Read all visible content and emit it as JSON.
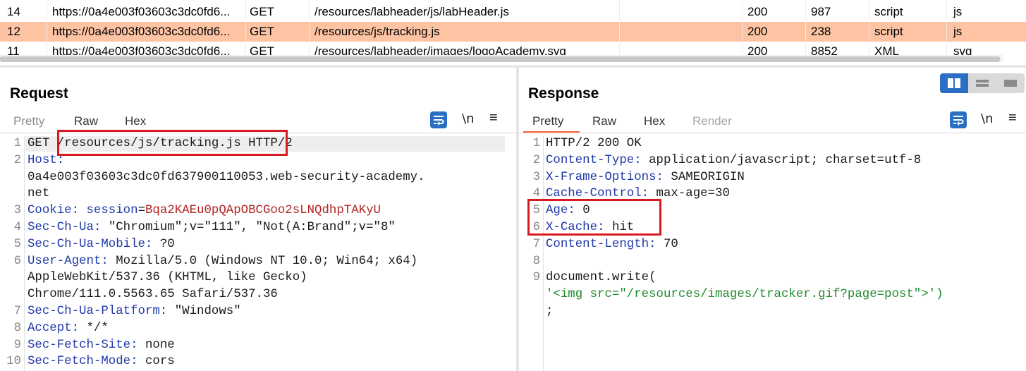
{
  "history": {
    "rows": [
      {
        "id": "14",
        "url": "https://0a4e003f03603c3dc0fd6...",
        "method": "GET",
        "path": "/resources/labheader/js/labHeader.js",
        "status": "200",
        "length": "987",
        "mime": "script",
        "ext": "js"
      },
      {
        "id": "12",
        "url": "https://0a4e003f03603c3dc0fd6...",
        "method": "GET",
        "path": "/resources/js/tracking.js",
        "status": "200",
        "length": "238",
        "mime": "script",
        "ext": "js"
      },
      {
        "id": "11",
        "url": "https://0a4e003f03603c3dc0fd6...",
        "method": "GET",
        "path": "/resources/labheader/images/logoAcademy.svg",
        "status": "200",
        "length": "8852",
        "mime": "XML",
        "ext": "svg"
      }
    ],
    "selected_row_index": 1,
    "selected_color": "#fdc3a3"
  },
  "request": {
    "title": "Request",
    "tabs": [
      "Pretty",
      "Raw",
      "Hex"
    ],
    "active_tab": "Raw",
    "newline_toggle": "\\n",
    "menu_glyph": "≡",
    "lines": [
      {
        "n": "1",
        "method": "GET",
        "path": "/resources/js/tracking.js",
        "proto": "HTTP/2"
      },
      {
        "n": "2",
        "key": "Host",
        "value": ""
      },
      {
        "n": "",
        "value": "0a4e003f03603c3dc0fd637900110053.web-security-academy."
      },
      {
        "n": "",
        "value": "net"
      },
      {
        "n": "3",
        "key": "Cookie",
        "ckey": "session",
        "cval": "Bqa2KAEu0pQApOBCGoo2sLNQdhpTAKyU"
      },
      {
        "n": "4",
        "key": "Sec-Ch-Ua",
        "value": "\"Chromium\";v=\"111\", \"Not(A:Brand\";v=\"8\""
      },
      {
        "n": "5",
        "key": "Sec-Ch-Ua-Mobile",
        "value": "?0"
      },
      {
        "n": "6",
        "key": "User-Agent",
        "value": "Mozilla/5.0 (Windows NT 10.0; Win64; x64)"
      },
      {
        "n": "",
        "value": "AppleWebKit/537.36 (KHTML, like Gecko)"
      },
      {
        "n": "",
        "value": "Chrome/111.0.5563.65 Safari/537.36"
      },
      {
        "n": "7",
        "key": "Sec-Ch-Ua-Platform",
        "value": "\"Windows\""
      },
      {
        "n": "8",
        "key": "Accept",
        "value": "*/*"
      },
      {
        "n": "9",
        "key": "Sec-Fetch-Site",
        "value": "none"
      },
      {
        "n": "10",
        "key": "Sec-Fetch-Mode",
        "value": "cors"
      }
    ]
  },
  "response": {
    "title": "Response",
    "tabs": [
      "Pretty",
      "Raw",
      "Hex",
      "Render"
    ],
    "active_tab": "Pretty",
    "newline_toggle": "\\n",
    "menu_glyph": "≡",
    "lines": [
      {
        "n": "1",
        "plain": "HTTP/2 200 OK"
      },
      {
        "n": "2",
        "key": "Content-Type",
        "value": "application/javascript; charset=utf-8"
      },
      {
        "n": "3",
        "key": "X-Frame-Options",
        "value": "SAMEORIGIN"
      },
      {
        "n": "4",
        "key": "Cache-Control",
        "value": "max-age=30"
      },
      {
        "n": "5",
        "key": "Age",
        "value": "0"
      },
      {
        "n": "6",
        "key": "X-Cache",
        "value": "hit"
      },
      {
        "n": "7",
        "key": "Content-Length",
        "value": "70"
      },
      {
        "n": "8",
        "plain": ""
      },
      {
        "n": "9",
        "plain": "document.write("
      },
      {
        "n": "",
        "str": "'<img src=\"/resources/images/tracker.gif?page=post\">')"
      },
      {
        "n": "",
        "plain": ";"
      }
    ]
  },
  "colors": {
    "accent": "#ff6633",
    "header_key": "#1f39a8",
    "cookie_value": "#b32424",
    "string": "#1f8a2b",
    "highlight_box": "#d81b23",
    "toggle_blue": "#2a6fc4"
  }
}
